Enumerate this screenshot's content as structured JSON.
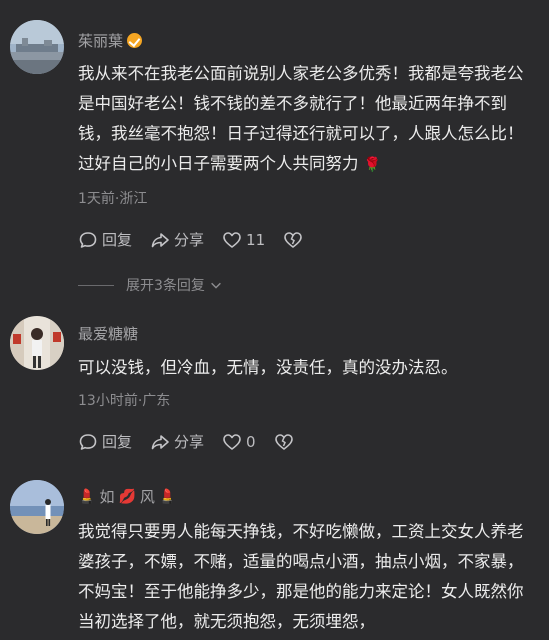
{
  "comments": [
    {
      "name": "茱丽葉",
      "text": "我从来不在我老公面前说别人家老公多优秀！我都是夸我老公是中国好老公！钱不钱的差不多就行了！他最近两年挣不到钱，我丝毫不抱怨！日子过得还行就可以了，人跟人怎么比！过好自己的小日子需要两个人共同努力",
      "text_emoji": "🌹",
      "meta": "1天前·浙江",
      "reply_label": "回复",
      "share_label": "分享",
      "like_count": "11",
      "expand_label": "展开3条回复"
    },
    {
      "name": "最爱糖糖",
      "text": "可以没钱，但冷血，无情，没责任，真的没办法忍。",
      "meta": "13小时前·广东",
      "reply_label": "回复",
      "share_label": "分享",
      "like_count": "0"
    },
    {
      "name_prefix": "💄",
      "name_mid1": "如",
      "name_lips": "💋",
      "name_mid2": "风",
      "name_suffix": "💄",
      "text": "我觉得只要男人能每天挣钱，不好吃懒做，工资上交女人养老婆孩子，不嫖，不赌，适量的喝点小酒，抽点小烟，不家暴，不妈宝！至于他能挣多少，那是他的能力来定论！女人既然你当初选择了他，就无须抱怨，无须埋怨，"
    }
  ],
  "icons": {
    "reply": "comment-bubble-icon",
    "share": "share-arrow-icon",
    "like": "heart-icon",
    "dislike": "broken-heart-icon",
    "expand": "chevron-down-icon",
    "verified": "orange-check-badge-icon"
  },
  "colors": {
    "background": "#2b2b2d",
    "text": "#ececec",
    "secondary": "#8d8d90",
    "badge": "#f5a623"
  }
}
